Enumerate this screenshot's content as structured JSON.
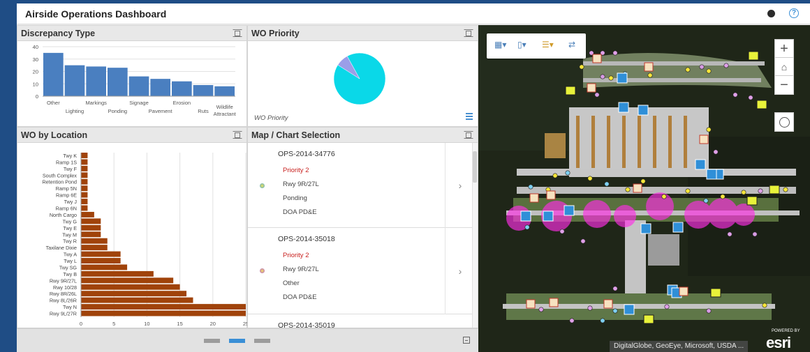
{
  "app": {
    "title": "Airside Operations Dashboard"
  },
  "panels": {
    "discrepancy": {
      "title": "Discrepancy Type"
    },
    "priority": {
      "title": "WO Priority",
      "caption": "WO Priority"
    },
    "location": {
      "title": "WO by Location"
    },
    "selection": {
      "title": "Map / Chart Selection"
    }
  },
  "chart_data": [
    {
      "type": "bar",
      "orientation": "vertical",
      "categories": [
        "Other",
        "Lighting",
        "Markings",
        "Ponding",
        "Signage",
        "Pavement",
        "Erosion",
        "Ruts",
        "Wildlife Attractant"
      ],
      "values": [
        35,
        25,
        24,
        23,
        16,
        14,
        12,
        9,
        8
      ],
      "ylim": [
        0,
        40
      ],
      "yticks": [
        0,
        10,
        20,
        30,
        40
      ],
      "grid": true,
      "color": "#4a7fc0"
    },
    {
      "type": "pie",
      "slices": [
        {
          "value": 92,
          "color": "#0ad8e8"
        },
        {
          "value": 8,
          "color": "#9b9ee8"
        }
      ]
    },
    {
      "type": "bar",
      "orientation": "horizontal",
      "categories": [
        "Twy K",
        "Ramp 1S",
        "Twy F",
        "South Complex",
        "Retention Pond",
        "Ramp 5N",
        "Ramp 6E",
        "Twy J",
        "Ramp 6N",
        "North Cargo",
        "Twy G",
        "Twy E",
        "Twy M",
        "Twy R",
        "Taxilane Dixie",
        "Twy A",
        "Twy L",
        "Twy SG",
        "Twy B",
        "Rwy 9R/27L",
        "Rwy 10/28",
        "Rwy 8R/26L",
        "Rwy 8L/26R",
        "Twy N",
        "Rwy 9L/27R"
      ],
      "values": [
        1,
        1,
        1,
        1,
        1,
        1,
        1,
        1,
        1,
        2,
        3,
        3,
        3,
        4,
        4,
        6,
        6,
        7,
        11,
        14,
        15,
        16,
        17,
        25,
        25
      ],
      "xlim": [
        0,
        25
      ],
      "xticks": [
        0,
        5,
        10,
        15,
        20,
        25
      ],
      "grid": true,
      "color": "#a0430a"
    }
  ],
  "selection_list": [
    {
      "id": "OPS-2014-34776",
      "priority": "Priority 2",
      "runway": "Rwy 9R/27L",
      "type": "Ponding",
      "dept": "DOA PD&E",
      "dot_color": "#d9c52a"
    },
    {
      "id": "OPS-2014-35018",
      "priority": "Priority 2",
      "runway": "Rwy 9R/27L",
      "type": "Other",
      "dept": "DOA PD&E",
      "dot_color": "#b25bd6"
    },
    {
      "id": "OPS-2014-35019"
    }
  ],
  "map": {
    "attribution": "DigitalGlobe, GeoEye, Microsoft, USDA ...",
    "logo_text": "esri",
    "logo_sub": "POWERED BY",
    "zoom_in": "+",
    "zoom_out": "−",
    "home_icon": "home-icon",
    "toolbar_icons": [
      "basemap-icon",
      "layers-icon",
      "legend-icon",
      "measure-icon"
    ]
  },
  "pager": {
    "pages": 3,
    "active": 1
  }
}
